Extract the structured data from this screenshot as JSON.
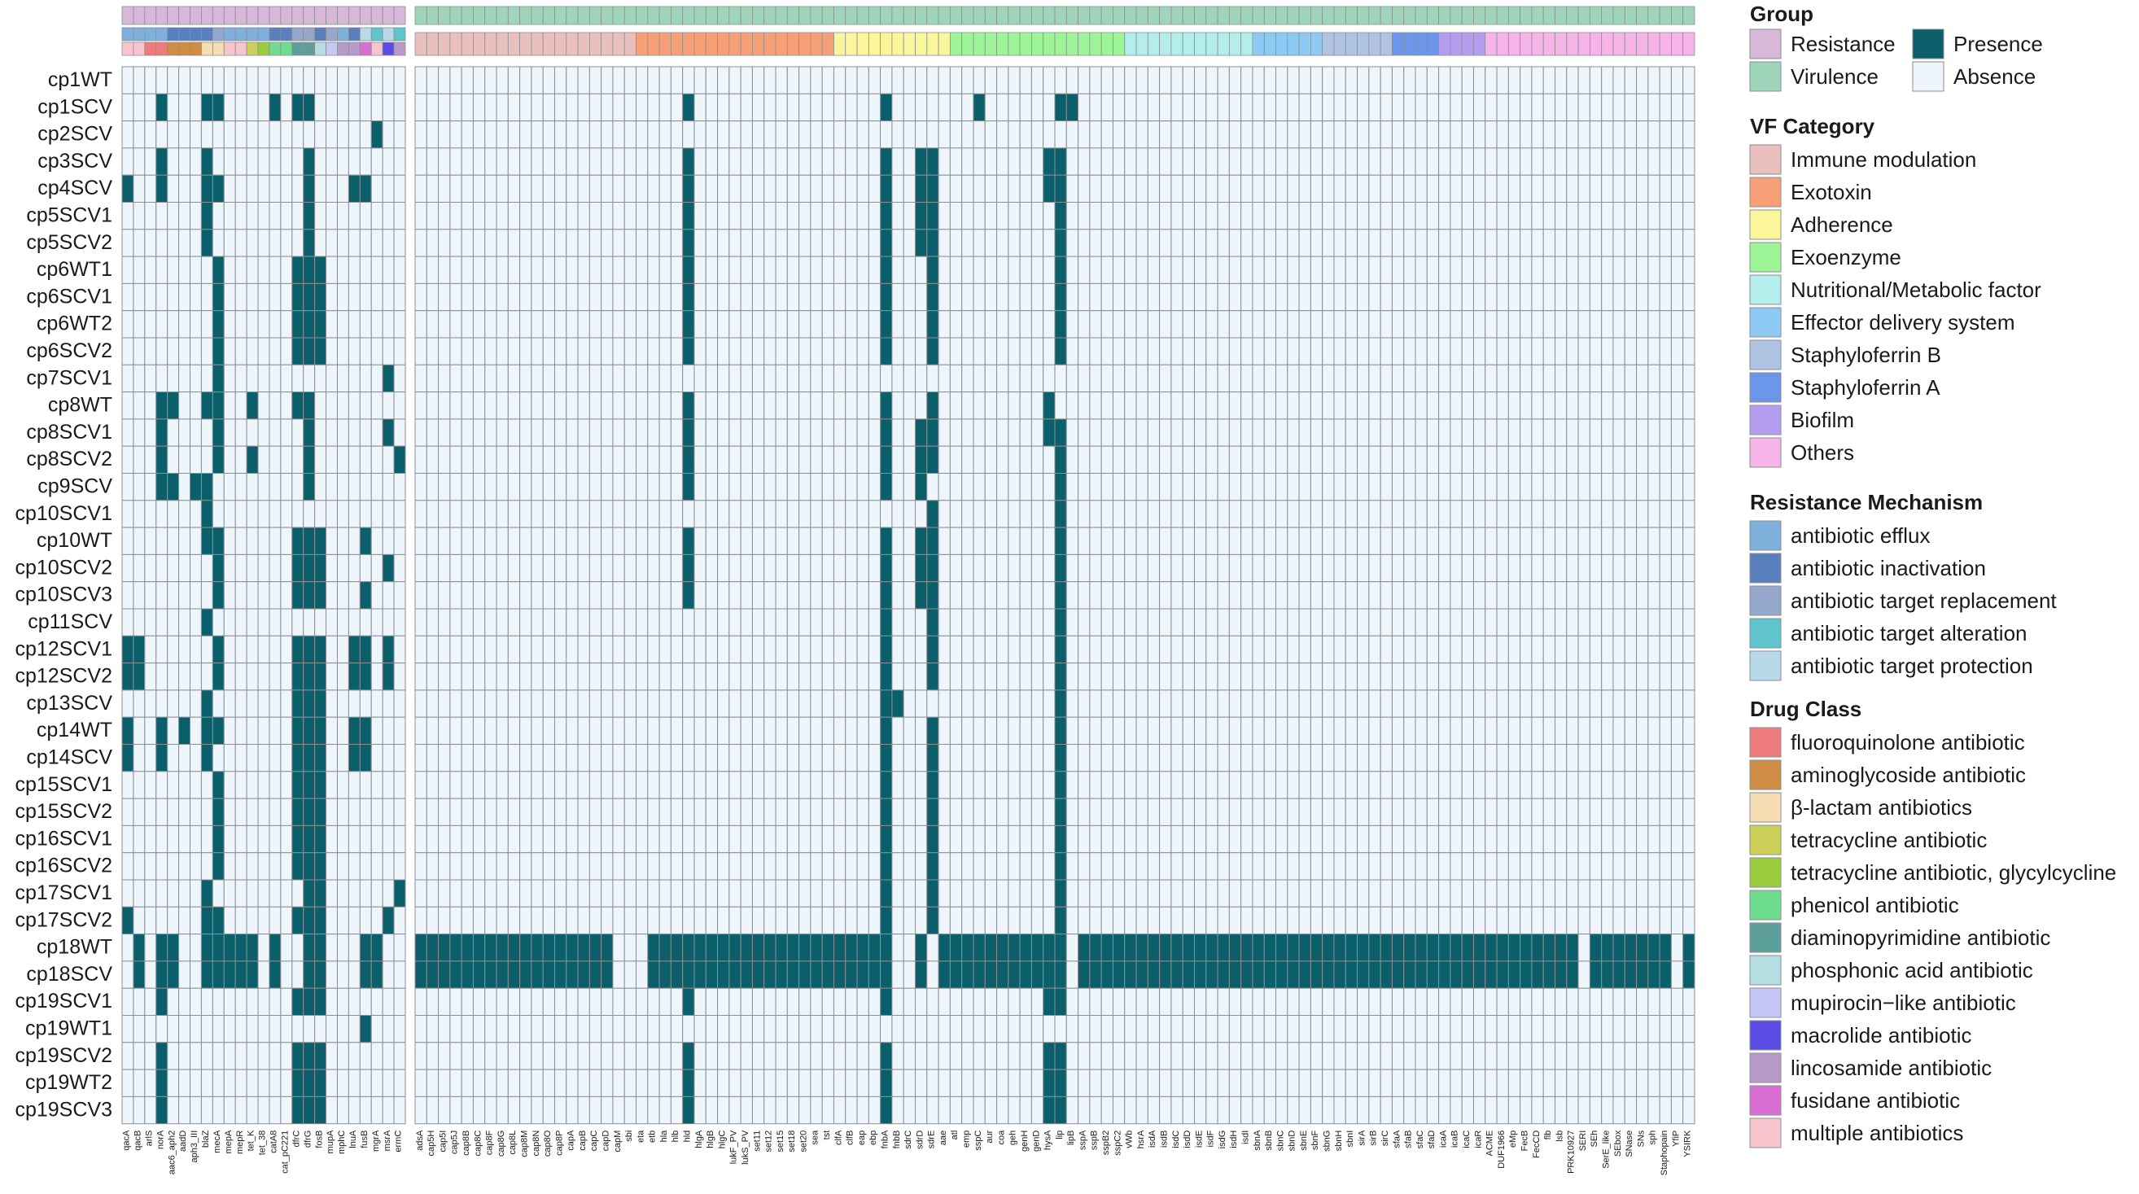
{
  "chart_data": {
    "type": "heatmap",
    "title": "",
    "value_legend": {
      "title": "",
      "presence": {
        "label": "Presence",
        "color": "#0b5f6b"
      },
      "absence": {
        "label": "Absence",
        "color": "#eef5fb"
      }
    },
    "rows": [
      "cp1WT",
      "cp1SCV",
      "cp2SCV",
      "cp3SCV",
      "cp4SCV",
      "cp5SCV1",
      "cp5SCV2",
      "cp6WT1",
      "cp6SCV1",
      "cp6WT2",
      "cp6SCV2",
      "cp7SCV1",
      "cp8WT",
      "cp8SCV1",
      "cp8SCV2",
      "cp9SCV",
      "cp10SCV1",
      "cp10WT",
      "cp10SCV2",
      "cp10SCV3",
      "cp11SCV",
      "cp12SCV1",
      "cp12SCV2",
      "cp13SCV",
      "cp14WT",
      "cp14SCV",
      "cp15SCV1",
      "cp15SCV2",
      "cp16SCV1",
      "cp16SCV2",
      "cp17SCV1",
      "cp17SCV2",
      "cp18WT",
      "cp18SCV",
      "cp19SCV1",
      "cp19WT1",
      "cp19SCV2",
      "cp19WT2",
      "cp19SCV3"
    ],
    "resistance_columns": {
      "genes": [
        "qacA",
        "qacB",
        "arlS",
        "norA",
        "aac6_aph2",
        "aadD",
        "aph3_III",
        "blaZ",
        "mecA",
        "mepA",
        "mepR",
        "tet_K",
        "tet_38",
        "catA8",
        "cat_pC221",
        "dfrC",
        "dfrG",
        "fosB",
        "mupA",
        "mphC",
        "lnuA",
        "fusB",
        "mgrA",
        "msrA",
        "ermC"
      ],
      "mechanism": [
        0,
        0,
        0,
        0,
        1,
        1,
        1,
        1,
        2,
        0,
        0,
        0,
        0,
        1,
        1,
        2,
        2,
        1,
        2,
        0,
        1,
        4,
        3,
        4,
        3
      ],
      "drug_class": [
        12,
        12,
        0,
        0,
        1,
        1,
        1,
        2,
        2,
        12,
        12,
        3,
        4,
        5,
        5,
        6,
        6,
        7,
        8,
        10,
        10,
        11,
        12,
        9,
        10
      ],
      "cells": [
        "0000000000000000000000000",
        "0001000110000101100000000",
        "0000000000000000000000100",
        "0001000100000000100000000",
        "1001000110000000100011000",
        "0000000100000000100000000",
        "0000000100000000100000000",
        "0000000010000001110000000",
        "0000000010000001110000000",
        "0000000010000001110000000",
        "0000000010000001110000000",
        "0000000010000000000000010",
        "0001100110010001100000000",
        "0001000010000000100000010",
        "0001000010010000100000001",
        "0001101100000000100000000",
        "0000000100000000000000000",
        "0000000110000001110001000",
        "0000000010000001110000010",
        "0000000010000001110001000",
        "0000000100000000000000000",
        "1100000010000001110011010",
        "1100000010000001110011010",
        "0000000100000001110000000",
        "1001010110000001110011000",
        "1001000100000001110011000",
        "0000000010000001110000000",
        "0000000010000001110000000",
        "0000000010000001110000000",
        "0000000010000001110000000",
        "0000000100000000110000001",
        "1000000110000001110000010",
        "0101100111110100110001100",
        "0101100111110100110001100",
        "0001000000000001110000000",
        "0000000000000000000001000",
        "0001000000000001110000000",
        "0001000000000001110000000",
        "0001000000000001110000000"
      ]
    },
    "virulence_columns": {
      "genes": [
        "adsA",
        "cap5H",
        "cap5I",
        "cap5J",
        "cap8B",
        "cap8C",
        "cap8F",
        "cap8G",
        "cap8L",
        "cap8M",
        "cap8N",
        "cap8O",
        "cap8P",
        "capA",
        "capB",
        "capC",
        "capD",
        "capM",
        "sbi",
        "eta",
        "etb",
        "hla",
        "hlb",
        "hld",
        "hlgA",
        "hlgB",
        "hlgC",
        "lukF_PV",
        "lukS_PV",
        "set11",
        "set12",
        "set15",
        "set18",
        "set20",
        "sea",
        "tst",
        "clfA",
        "clfB",
        "eap",
        "ebp",
        "fnbA",
        "fnbB",
        "sdrC",
        "sdrD",
        "sdrE",
        "aae",
        "atl",
        "emp",
        "sspC",
        "aur",
        "coa",
        "geh",
        "genH",
        "genD",
        "hysA",
        "lip",
        "lipB",
        "sspA",
        "sspB",
        "sspB2",
        "sspC2",
        "vWb",
        "hsrA",
        "isdA",
        "isdB",
        "isdC",
        "isdD",
        "isdE",
        "isdF",
        "isdG",
        "isdH",
        "isdI",
        "sbnA",
        "sbnB",
        "sbnC",
        "sbnD",
        "sbnE",
        "sbnF",
        "sbnG",
        "sbnH",
        "sbnI",
        "sirA",
        "sirB",
        "sirC",
        "sfaA",
        "sfaB",
        "sfaC",
        "sfaD",
        "icaA",
        "icaB",
        "icaC",
        "icaR",
        "ACME",
        "DUF1966",
        "eMp",
        "FecB",
        "FecCD",
        "flb",
        "lsb",
        "PRK10927",
        "SERI",
        "SEh",
        "SerE_like",
        "SEbox",
        "SNase",
        "SNs",
        "sph",
        "Staphopain",
        "YfiP",
        "YSIRK"
      ],
      "vf_category": [
        0,
        0,
        0,
        0,
        0,
        0,
        0,
        0,
        0,
        0,
        0,
        0,
        0,
        0,
        0,
        0,
        0,
        0,
        0,
        1,
        1,
        1,
        1,
        1,
        1,
        1,
        1,
        1,
        1,
        1,
        1,
        1,
        1,
        1,
        1,
        1,
        2,
        2,
        2,
        2,
        2,
        2,
        2,
        2,
        2,
        2,
        3,
        3,
        3,
        3,
        3,
        3,
        3,
        3,
        3,
        3,
        3,
        3,
        3,
        3,
        3,
        4,
        4,
        4,
        4,
        4,
        4,
        4,
        4,
        4,
        4,
        4,
        5,
        5,
        5,
        5,
        5,
        5,
        6,
        6,
        6,
        6,
        6,
        6,
        7,
        7,
        7,
        7,
        8,
        8,
        8,
        8,
        9,
        9,
        9,
        9,
        9,
        9,
        9,
        9,
        9,
        9,
        9,
        9,
        9,
        9,
        9,
        9,
        9,
        9,
        9,
        9
      ],
      "cells": [
        "00000000000000000000000000000000000000000000000000000000000000000000000000000000000000000000000000000000000000000000",
        "00000000000000000000000100000000000000001000000010000001100000000000000000000000000000000000000000000000000000000001",
        "00000000000000000000000000000000000000000000000000000000000000000000000000000000000000000000000000000000000000000000",
        "00000000000000000000000100000000000000001001100000000011000000000000000000000000000000000000000000000000000000000001",
        "00000000000000000000000100000000000000001001100000000011000000000000000000000000000000000000000000000000000000000001",
        "00000000000000000000000100000000000000001001100000000001000000000000000000000000000000000000000000000000000000000001",
        "00000000000000000000000100000000000000001001100000000001000000000000000000000000000000000000000000000000000000000001",
        "00000000000000000000000100000000000000001000100000000001000000000000000000000000000000000000000000000000000000000000",
        "00000000000000000000000100000000000000001000100000000001000000000000000000000000000000000000000000000000000000000000",
        "00000000000000000000000100000000000000001000100000000001000000000000000000000000000000000000000000000000000000000000",
        "00000000000000000000000100000000000000001000100000000001000000000000000000000000000000000000000000000000000000000000",
        "00000000000000000000000000000000000000000000000000000000000000000000000000000000000000000000000000000000000000000000",
        "00000000000000000000000100000000000000001000100000000010000000000000000000000000000000000000000000000000000000000001",
        "00000000000000000000000100000000000000001001100000000011000000000000000000000000000000000000000000000000000000000001",
        "00000000000000000000000100000000000000001001100000000001000000000000000000000000000000000000000000000000000000000001",
        "00000000000000000000000100000000000000001001000000000001000000000000000000000000000000000000000000000000000000000000",
        "00000000000000000000000000000000000000000000100000000001000000000000000000000000000000000000000000000000000000000000",
        "00000000000000000000000100000000000000001001100000000001000000000000000000000000000000000000000000000000000000000000",
        "00000000000000000000000100000000000000001001100000000001000000000000000000000000000000000000000000000000000000000000",
        "00000000000000000000000100000000000000001001100000000001000000000000000000000000000000000000000000000000000000000000",
        "00000000000000000000000000000000000000001000100000000001000000000000000000000000000000000000000000000000000000000000",
        "00000000000000000000000000000000000000001000100000000001000000000000000000000000000000000000000000000000000000000000",
        "00000000000000000000000000000000000000001000100000000001000000000000000000000000000000000000000000000000000000000000",
        "00000000000000000000000000000000000000001100000000000001000000000000000000000000000000000000000000000000000000000000",
        "00000000000000000000000000000000000000001000100000000001000000000000000000000000000000000000000000000000000000000000",
        "00000000000000000000000000000000000000001000100000000001000000000000000000000000000000000000000000000000000000000000",
        "00000000000000000000000000000000000000001000100000000001000000000000000000000000000000000000000000000000000000000000",
        "00000000000000000000000000000000000000001000100000000001000000000000000000000000000000000000000000000000000000000000",
        "00000000000000000000000000000000000000001000100000000001000000000000000000000000000000000000000000000000000000000000",
        "00000000000000000000000000000000000000001000100000000001000000000000000000000000000000000000000000000000000000000000",
        "00000000000000000000000000000000000000001000100000000001000000000000000000000000000000000000000000000000000000000000",
        "00000000000000000000000000000000000000001000100000000001000000000000000000000000000000000000000000000000000000000000",
        "11111111111111111000111111111111111111111001011111111111011111111111111111111111111111111111111111110111111101111101",
        "11111111111111111000111111111111111111111001011111111111011111111111111111111111111111111111111111110111111101111101",
        "00000000000000000000000100000000000000001000000000000011000000000000000000000000000000000000000000000000000000000000",
        "00000000000000000000000000000000000000000000000000000000000000000000000000000000000000000000000000000000000000000000",
        "00000000000000000000000100000000000000001000000000000011000000000000000000000000000000000000000000000000000000000000",
        "00000000000000000000000100000000000000001000000000000011000000000000000000000000000000000000000000000000000000000000",
        "00000000000000000000000100000000000000001000000000000011000000000000000000000000000000000000000000000000000000000000"
      ],
      "extra_presence": {
        "sbnA_block": "",
        "eMp_FecB_sph_cols": ""
      }
    },
    "legends": {
      "group": {
        "title": "Group",
        "items": [
          {
            "label": "Resistance",
            "color": "#d7b8d8"
          },
          {
            "label": "Virulence",
            "color": "#9fd6bb"
          }
        ]
      },
      "vf_category": {
        "title": "VF Category",
        "items": [
          {
            "label": "Immune modulation",
            "color": "#e9c0bd"
          },
          {
            "label": "Exotoxin",
            "color": "#f7a078"
          },
          {
            "label": "Adherence",
            "color": "#fbf59c"
          },
          {
            "label": "Exoenzyme",
            "color": "#9ef597"
          },
          {
            "label": "Nutritional/Metabolic factor",
            "color": "#b3edec"
          },
          {
            "label": "Effector delivery system",
            "color": "#8ecbf4"
          },
          {
            "label": "Staphyloferrin B",
            "color": "#b1c3e3"
          },
          {
            "label": "Staphyloferrin A",
            "color": "#6c96ea"
          },
          {
            "label": "Biofilm",
            "color": "#b49cef"
          },
          {
            "label": "Others",
            "color": "#f6b4e8"
          }
        ]
      },
      "resistance_mechanism": {
        "title": "Resistance Mechanism",
        "items": [
          {
            "label": "antibiotic efflux",
            "color": "#7fb0dc"
          },
          {
            "label": "antibiotic inactivation",
            "color": "#5a7fbd"
          },
          {
            "label": "antibiotic target replacement",
            "color": "#95a8cc"
          },
          {
            "label": "antibiotic target alteration",
            "color": "#60c4cf"
          },
          {
            "label": "antibiotic target protection",
            "color": "#b8d9ea"
          }
        ]
      },
      "drug_class": {
        "title": "Drug Class",
        "items": [
          {
            "label": "fluoroquinolone antibiotic",
            "color": "#ed7b7b"
          },
          {
            "label": "aminoglycoside antibiotic",
            "color": "#cf8c45"
          },
          {
            "label": "β-lactam antibiotics",
            "color": "#f6ddb3"
          },
          {
            "label": "tetracycline antibiotic",
            "color": "#cccf58"
          },
          {
            "label": "tetracycline antibiotic, glycylcycline",
            "color": "#9acd3e"
          },
          {
            "label": "phenicol antibiotic",
            "color": "#6fdd8e"
          },
          {
            "label": "diaminopyrimidine antibiotic",
            "color": "#5d9f9b"
          },
          {
            "label": "phosphonic acid antibiotic",
            "color": "#b5dee2"
          },
          {
            "label": "mupirocin−like antibiotic",
            "color": "#c6c6f7"
          },
          {
            "label": "macrolide antibiotic",
            "color": "#5a4be3"
          },
          {
            "label": "lincosamide antibiotic",
            "color": "#b69ac9"
          },
          {
            "label": "fusidane antibiotic",
            "color": "#d96fd2"
          },
          {
            "label": "multiple antibiotics",
            "color": "#f8c5cf"
          }
        ]
      }
    }
  }
}
